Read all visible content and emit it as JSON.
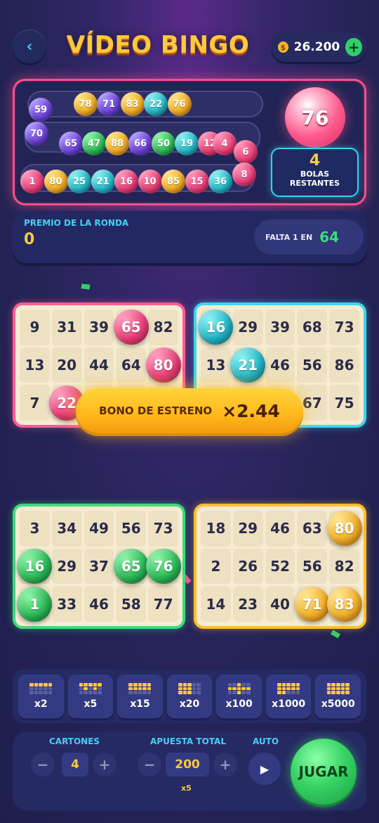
{
  "header": {
    "back_icon": "chevron-left-icon",
    "title": "VÍDEO BINGO",
    "balance": "26.200",
    "coin_symbol": "$",
    "add_label": "+"
  },
  "draw": {
    "row1": [
      "59",
      "78",
      "71",
      "83",
      "22",
      "76"
    ],
    "row1_colors": [
      "purple",
      "gold",
      "purple",
      "gold",
      "teal",
      "gold"
    ],
    "row2": [
      "70",
      "65",
      "47",
      "88",
      "66",
      "50",
      "19",
      "12",
      "4",
      "6"
    ],
    "row2_colors": [
      "purple",
      "purple",
      "green",
      "gold",
      "purple",
      "green",
      "teal",
      "pink",
      "pink",
      "pink"
    ],
    "row3": [
      "1",
      "80",
      "25",
      "21",
      "16",
      "10",
      "85",
      "15",
      "36",
      "8"
    ],
    "row3_colors": [
      "pink",
      "gold",
      "teal",
      "teal",
      "pink",
      "pink",
      "gold",
      "pink",
      "teal",
      "pink"
    ],
    "current_ball": "76",
    "remaining_count": "4",
    "remaining_label_1": "BOLAS",
    "remaining_label_2": "RESTANTES"
  },
  "prize": {
    "label": "PREMIO DE LA RONDA",
    "value": "0",
    "missing_label": "FALTA 1 EN",
    "missing_value": "64"
  },
  "cards": [
    {
      "color": "#ff5c93",
      "cells": [
        "9",
        "31",
        "39",
        "65",
        "82",
        "13",
        "20",
        "44",
        "64",
        "80",
        "7",
        "22",
        "",
        "",
        ""
      ],
      "marked": [
        "65",
        "80",
        "22"
      ],
      "mark_color": "pink"
    },
    {
      "color": "#3fd6ea",
      "cells": [
        "16",
        "29",
        "39",
        "68",
        "73",
        "13",
        "21",
        "46",
        "56",
        "86",
        "",
        "",
        "",
        "67",
        "75"
      ],
      "marked": [
        "16",
        "21"
      ],
      "mark_color": "teal"
    },
    {
      "color": "#3edb7c",
      "cells": [
        "3",
        "34",
        "49",
        "56",
        "73",
        "16",
        "29",
        "37",
        "65",
        "76",
        "1",
        "33",
        "46",
        "58",
        "77"
      ],
      "marked": [
        "16",
        "65",
        "76",
        "1"
      ],
      "mark_color": "green"
    },
    {
      "color": "#ffbe2e",
      "cells": [
        "18",
        "29",
        "46",
        "63",
        "80",
        "2",
        "26",
        "52",
        "56",
        "82",
        "14",
        "23",
        "40",
        "71",
        "83"
      ],
      "marked": [
        "80",
        "71",
        "83"
      ],
      "mark_color": "gold"
    }
  ],
  "bonus": {
    "label": "BONO DE ESTRENO",
    "value": "×2.44"
  },
  "patterns": [
    {
      "label": "x2",
      "on": [
        0,
        1,
        2,
        3,
        4
      ]
    },
    {
      "label": "x5",
      "on": [
        0,
        1,
        2,
        3,
        4,
        6,
        8
      ]
    },
    {
      "label": "x15",
      "on": [
        0,
        1,
        2,
        3,
        4,
        5,
        6,
        7,
        8,
        9
      ]
    },
    {
      "label": "x20",
      "on": [
        0,
        1,
        2,
        5,
        6,
        7,
        10,
        11,
        12
      ]
    },
    {
      "label": "x100",
      "on": [
        2,
        5,
        6,
        7,
        8,
        9,
        12
      ]
    },
    {
      "label": "x1000",
      "on": [
        0,
        1,
        2,
        3,
        4,
        5,
        6,
        7,
        8,
        9,
        10,
        11
      ]
    },
    {
      "label": "x5000",
      "on": [
        0,
        1,
        2,
        3,
        4,
        5,
        6,
        7,
        8,
        9,
        10,
        11,
        12,
        13,
        14
      ]
    }
  ],
  "controls": {
    "cards_label": "CARTONES",
    "cards_value": "4",
    "bet_label": "APUESTA TOTAL",
    "bet_value": "200",
    "bet_multiplier": "x5",
    "auto_label": "AUTO",
    "minus": "−",
    "plus": "+",
    "play_icon": "▶",
    "jugar_label": "JUGAR"
  }
}
